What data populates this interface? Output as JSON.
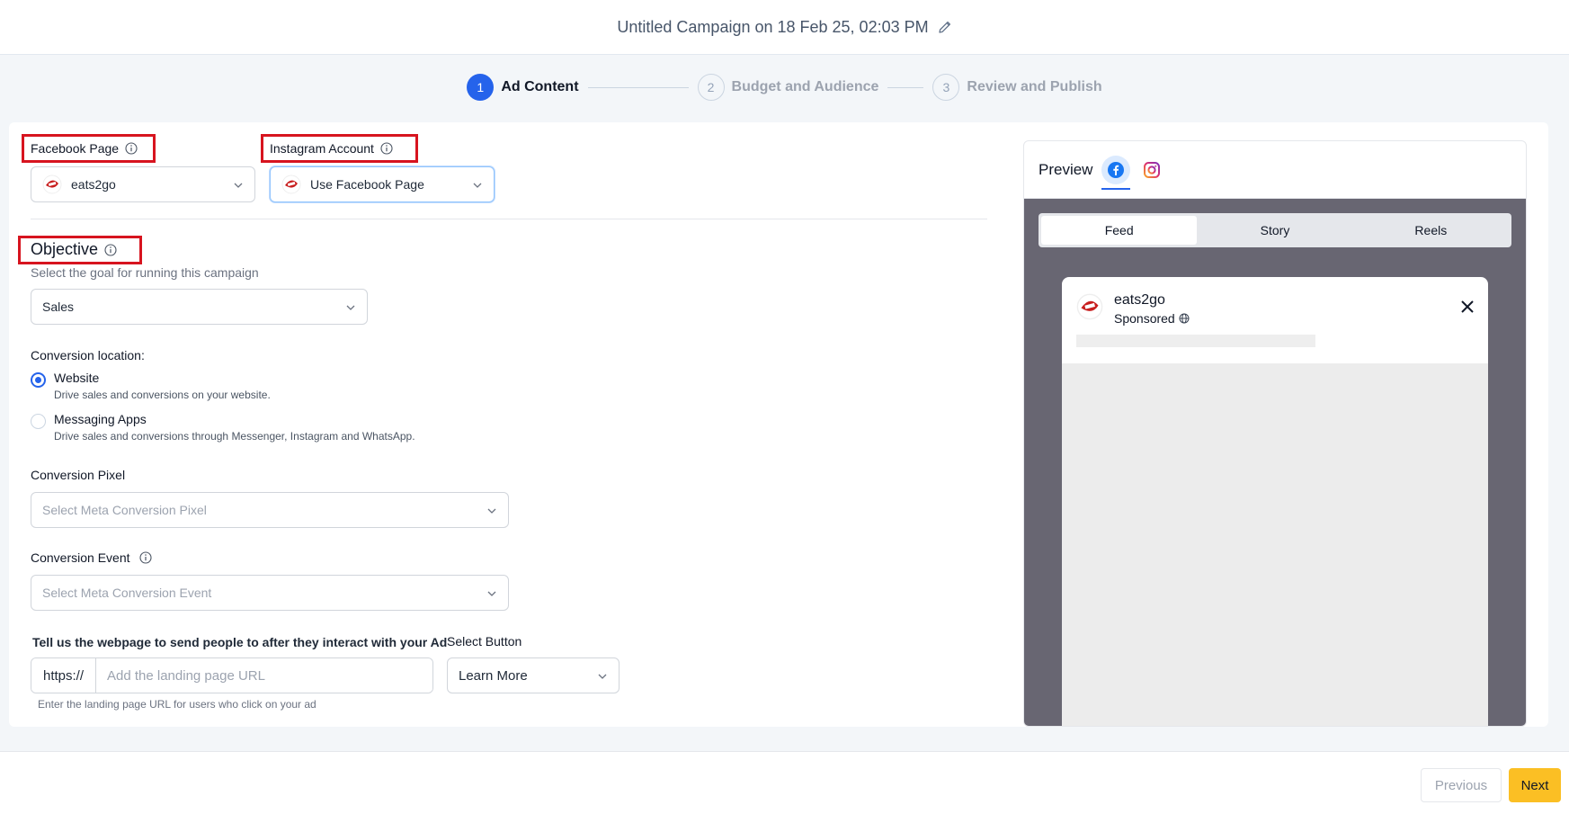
{
  "header": {
    "title": "Untitled Campaign on 18 Feb 25, 02:03 PM"
  },
  "stepper": [
    {
      "num": "1",
      "label": "Ad Content"
    },
    {
      "num": "2",
      "label": "Budget and Audience"
    },
    {
      "num": "3",
      "label": "Review and Publish"
    }
  ],
  "form": {
    "facebook_page": {
      "label": "Facebook Page",
      "value": "eats2go"
    },
    "instagram_account": {
      "label": "Instagram Account",
      "value": "Use Facebook Page"
    },
    "objective": {
      "title": "Objective",
      "subtitle": "Select the goal for running this campaign",
      "value": "Sales"
    },
    "conversion_location": {
      "label": "Conversion location:",
      "options": [
        {
          "title": "Website",
          "desc": "Drive sales and conversions on your website."
        },
        {
          "title": "Messaging Apps",
          "desc": "Drive sales and conversions through Messenger, Instagram and WhatsApp."
        }
      ]
    },
    "conversion_pixel": {
      "label": "Conversion Pixel",
      "placeholder": "Select Meta Conversion Pixel"
    },
    "conversion_event": {
      "label": "Conversion Event",
      "placeholder": "Select Meta Conversion Event"
    },
    "landing": {
      "label": "Tell us the webpage to send people to after they interact with your Ad",
      "prefix": "https://",
      "placeholder": "Add the landing page URL",
      "help": "Enter the landing page URL for users who click on your ad"
    },
    "select_button": {
      "label": "Select Button",
      "value": "Learn More"
    }
  },
  "preview": {
    "title": "Preview",
    "tabs": [
      "Feed",
      "Story",
      "Reels"
    ],
    "post": {
      "name": "eats2go",
      "sponsored": "Sponsored"
    }
  },
  "footer": {
    "previous": "Previous",
    "next": "Next"
  },
  "colors": {
    "accent": "#2563eb",
    "highlight": "#d7141f",
    "next_button": "#fbbf24"
  }
}
